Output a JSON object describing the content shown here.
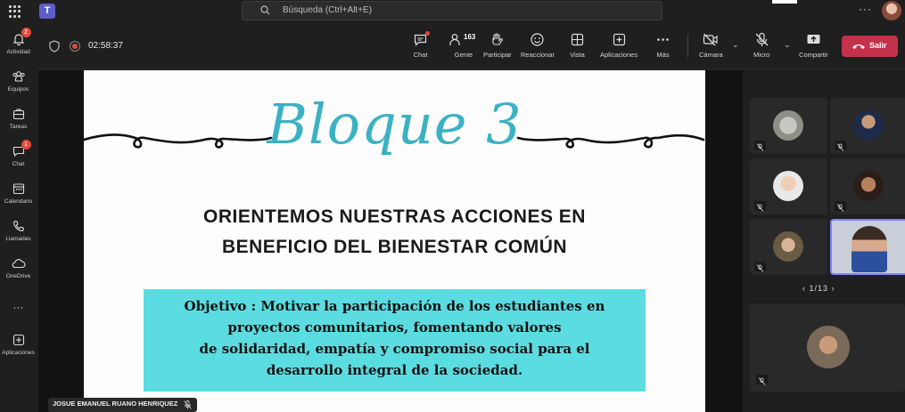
{
  "topbar": {
    "search_placeholder": "Búsqueda (Ctrl+Alt+E)",
    "more": "···"
  },
  "rail": [
    {
      "name": "actividad",
      "label": "Actividad",
      "badge": "2",
      "icon": "bell-icon"
    },
    {
      "name": "equipos",
      "label": "Equipos",
      "badge": "",
      "icon": "teams-icon"
    },
    {
      "name": "tareas",
      "label": "Tareas",
      "badge": "",
      "icon": "bag-icon"
    },
    {
      "name": "chat",
      "label": "Chat",
      "badge": "1",
      "icon": "chat-icon"
    },
    {
      "name": "calendario",
      "label": "Calendario",
      "badge": "",
      "icon": "calendar-icon"
    },
    {
      "name": "llamadas",
      "label": "Llamadas",
      "badge": "",
      "icon": "phone-icon"
    },
    {
      "name": "onedrive",
      "label": "OneDrive",
      "badge": "",
      "icon": "cloud-icon"
    },
    {
      "name": "more",
      "label": "···",
      "badge": "",
      "icon": "more-icon"
    },
    {
      "name": "aplicaciones",
      "label": "Aplicaciones",
      "badge": "",
      "icon": "apps-icon"
    }
  ],
  "meeting": {
    "timer": "02:58:37",
    "people_count": "163",
    "buttons": {
      "chat": "Chat",
      "gente": "Gente",
      "participar": "Participar",
      "reaccionar": "Reaccionar",
      "vista": "Vista",
      "aplicaciones": "Aplicaciones",
      "mas": "Más",
      "camara": "Cámara",
      "micro": "Micro",
      "compartir": "Compartir",
      "salir": "Salir"
    }
  },
  "slide": {
    "title": "Bloque 3",
    "heading_line1": "ORIENTEMOS NUESTRAS ACCIONES EN",
    "heading_line2": "BENEFICIO DEL BIENESTAR COMÚN",
    "objective_lines": [
      "Objetivo : Motivar la participación de los estudiantes en",
      "proyectos comunitarios, fomentando valores",
      "de solidaridad, empatía y compromiso social para el",
      "desarrollo integral de la sociedad."
    ]
  },
  "presenter_name": "JOSUE EMANUEL RUANO HENRIQUEZ",
  "gallery": {
    "pager": "1/13"
  },
  "colors": {
    "accent": "#5b5fc7",
    "leave": "#c4314b",
    "slide_title": "#3bb1c4",
    "objective_bg": "#5bdce0"
  }
}
